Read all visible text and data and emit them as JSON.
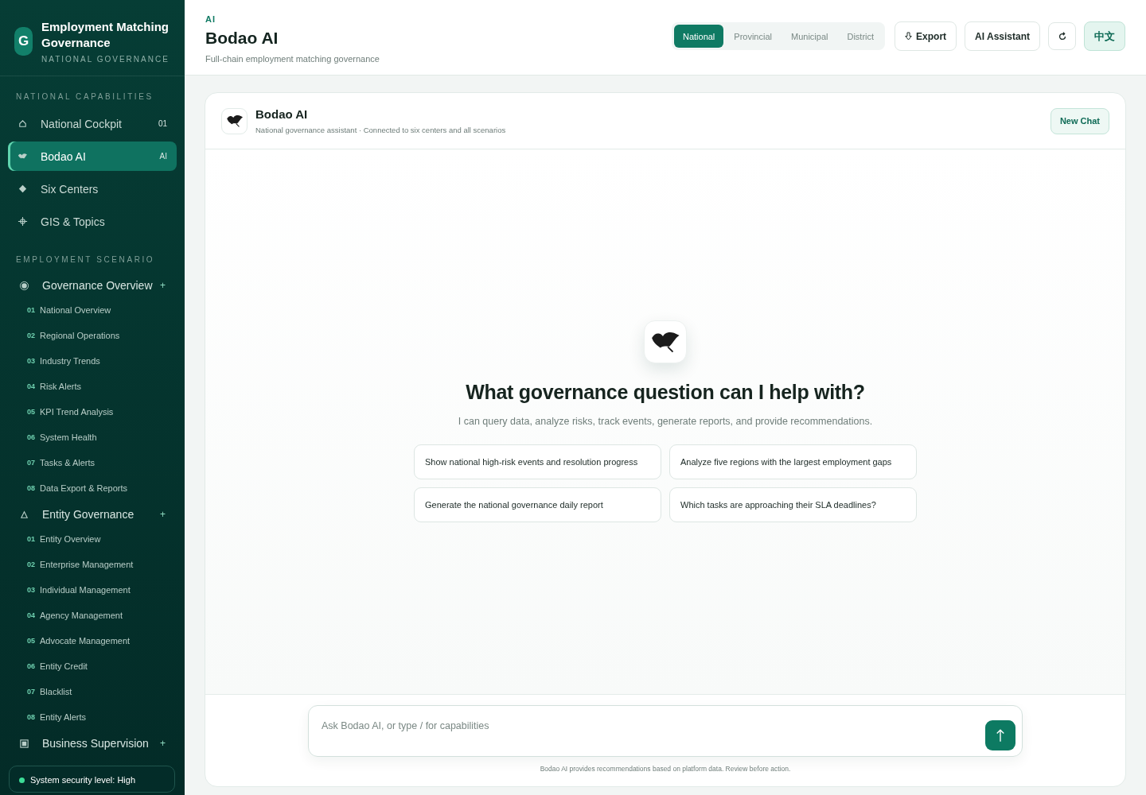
{
  "brand": {
    "logo": "G",
    "title": "Employment Matching Governance",
    "subtitle": "NATIONAL GOVERNANCE"
  },
  "sidebar": {
    "sections": [
      {
        "label": "NATIONAL CAPABILITIES",
        "items": [
          {
            "label": "National Cockpit",
            "badge": "01",
            "selected": false
          },
          {
            "label": "Bodao AI",
            "badge": "AI",
            "selected": true
          },
          {
            "label": "Six Centers",
            "selected": false
          },
          {
            "label": "GIS & Topics",
            "selected": false
          }
        ]
      },
      {
        "label": "EMPLOYMENT SCENARIO",
        "groups": [
          {
            "label": "Governance Overview",
            "toggle": "+",
            "children": [
              {
                "number": "01",
                "label": "National Overview"
              },
              {
                "number": "02",
                "label": "Regional Operations"
              },
              {
                "number": "03",
                "label": "Industry Trends"
              },
              {
                "number": "04",
                "label": "Risk Alerts"
              },
              {
                "number": "05",
                "label": "KPI Trend Analysis"
              },
              {
                "number": "06",
                "label": "System Health"
              },
              {
                "number": "07",
                "label": "Tasks & Alerts"
              },
              {
                "number": "08",
                "label": "Data Export & Reports"
              }
            ]
          },
          {
            "label": "Entity Governance",
            "toggle": "+",
            "children": [
              {
                "number": "01",
                "label": "Entity Overview"
              },
              {
                "number": "02",
                "label": "Enterprise Management"
              },
              {
                "number": "03",
                "label": "Individual Management"
              },
              {
                "number": "04",
                "label": "Agency Management"
              },
              {
                "number": "05",
                "label": "Advocate Management"
              },
              {
                "number": "06",
                "label": "Entity Credit"
              },
              {
                "number": "07",
                "label": "Blacklist"
              },
              {
                "number": "08",
                "label": "Entity Alerts"
              }
            ]
          },
          {
            "label": "Business Supervision",
            "toggle": "+"
          }
        ]
      }
    ],
    "security": {
      "text": "System security level: High",
      "color": "#3ddc97"
    }
  },
  "header": {
    "eyebrow": "AI",
    "title": "Bodao AI",
    "subtitle": "Full-chain employment matching governance",
    "levels": [
      {
        "label": "National",
        "selected": true
      },
      {
        "label": "Provincial",
        "selected": false
      },
      {
        "label": "Municipal",
        "selected": false
      },
      {
        "label": "District",
        "selected": false
      }
    ],
    "export": "Export",
    "assistant": "AI Assistant",
    "language": "中文"
  },
  "chat": {
    "title": "Bodao AI",
    "subtitle": "National governance assistant · Connected to six centers and all scenarios",
    "new_chat": "New Chat",
    "heading": "What governance question can I help with?",
    "intro": "I can query data, analyze risks, track events, generate reports, and provide recommendations.",
    "suggestions": [
      "Show national high-risk events and resolution progress",
      "Analyze five regions with the largest employment gaps",
      "Generate the national governance daily report",
      "Which tasks are approaching their SLA deadlines?"
    ],
    "input": {
      "placeholder": "Ask Bodao AI, or type / for capabilities"
    },
    "disclaimer": "Bodao AI provides recommendations based on platform data. Review before action."
  }
}
